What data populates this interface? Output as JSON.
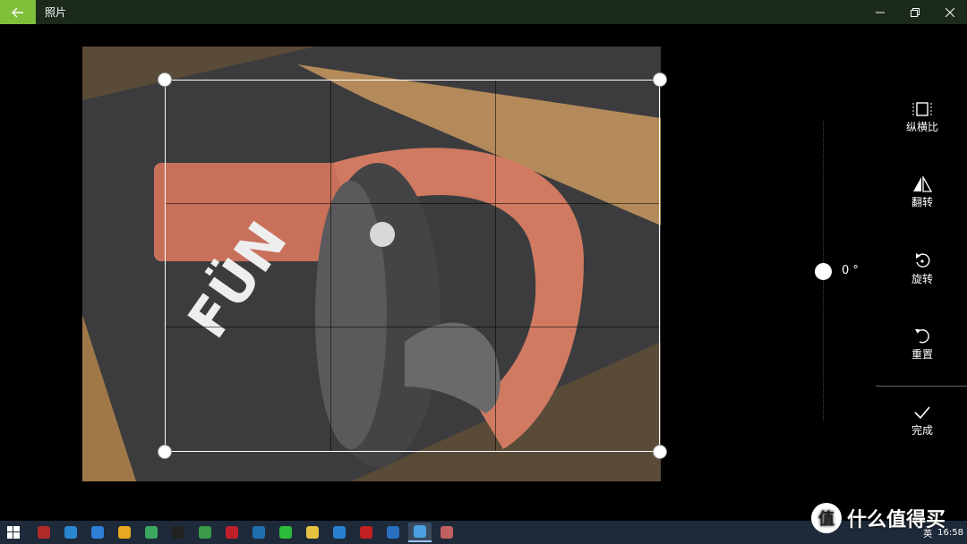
{
  "titlebar": {
    "app_title": "照片",
    "icons": {
      "back": "back-arrow-icon",
      "minimize": "minimize-icon",
      "restore": "restore-icon",
      "close": "close-icon"
    }
  },
  "editor": {
    "rotation_value": "0 °",
    "tools": [
      {
        "id": "aspect",
        "label": "纵横比",
        "icon": "aspect-ratio-icon"
      },
      {
        "id": "flip",
        "label": "翻转",
        "icon": "flip-icon"
      },
      {
        "id": "rotate",
        "label": "旋转",
        "icon": "rotate-icon"
      },
      {
        "id": "reset",
        "label": "重置",
        "icon": "reset-icon"
      },
      {
        "id": "done",
        "label": "完成",
        "icon": "checkmark-icon"
      }
    ]
  },
  "taskbar": {
    "apps": [
      {
        "name": "app-red-book",
        "color": "#b02a2a"
      },
      {
        "name": "app-messenger",
        "color": "#2a86d1"
      },
      {
        "name": "app-wps",
        "color": "#2f7fd6"
      },
      {
        "name": "app-yellow",
        "color": "#e8a920"
      },
      {
        "name": "app-green-cube",
        "color": "#3aa860"
      },
      {
        "name": "app-terminal",
        "color": "#222222"
      },
      {
        "name": "app-map",
        "color": "#3a9a4a"
      },
      {
        "name": "app-flower",
        "color": "#c0202a"
      },
      {
        "name": "app-blue-circle",
        "color": "#1f6fb0"
      },
      {
        "name": "app-wechat",
        "color": "#2dbb3a"
      },
      {
        "name": "app-folder",
        "color": "#e8c040"
      },
      {
        "name": "app-bird",
        "color": "#2a7fd0"
      },
      {
        "name": "app-red-circle",
        "color": "#c02020"
      },
      {
        "name": "app-chat",
        "color": "#2a70c0"
      },
      {
        "name": "app-photos",
        "color": "#4aa0e0",
        "active": true
      },
      {
        "name": "app-paint",
        "color": "#c06060"
      }
    ],
    "tray": {
      "ime": "英",
      "time": "16:58"
    }
  },
  "watermark": {
    "text": "什么值得买",
    "logo": "值"
  },
  "colors": {
    "accent": "#7fbf3a"
  }
}
